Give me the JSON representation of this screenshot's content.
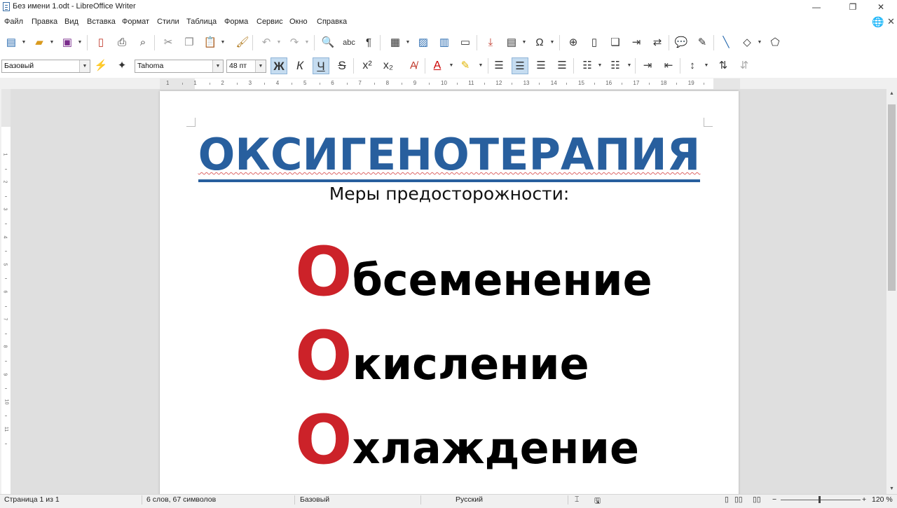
{
  "window": {
    "title": "Без имени 1.odt - LibreOffice Writer",
    "minimize": "—",
    "restore": "❐",
    "close": "✕"
  },
  "menu": {
    "items": [
      "Файл",
      "Правка",
      "Вид",
      "Вставка",
      "Формат",
      "Стили",
      "Таблица",
      "Форма",
      "Сервис",
      "Окно",
      "Справка"
    ]
  },
  "formatting": {
    "paragraph_style": "Базовый",
    "font_name": "Tahoma",
    "font_size": "48 пт",
    "bold_label": "Ж",
    "italic_label": "К",
    "underline_label": "Ч",
    "strike_label": "S",
    "superscript_label": "x²",
    "subscript_label": "x₂"
  },
  "ruler": {
    "h_labels": [
      "1",
      "1",
      "2",
      "3",
      "4",
      "5",
      "6",
      "7",
      "8",
      "9",
      "10",
      "11",
      "12",
      "13",
      "14",
      "15",
      "16",
      "17",
      "18",
      "19"
    ],
    "v_labels": [
      "1",
      "2",
      "3",
      "4",
      "5",
      "6",
      "7",
      "8",
      "9",
      "10",
      "11"
    ]
  },
  "document": {
    "heading": "ОКСИГЕНОТЕРАПИЯ",
    "subtitle": "Меры предосторожности:",
    "lines": [
      {
        "cap": "О",
        "rest": "бсеменение"
      },
      {
        "cap": "О",
        "rest": "кисление"
      },
      {
        "cap": "О",
        "rest": "хлаждение"
      }
    ]
  },
  "status": {
    "page": "Страница 1 из 1",
    "words": "6 слов, 67 символов",
    "style": "Базовый",
    "language": "Русский",
    "zoom": "120 %"
  },
  "colors": {
    "heading": "#285f9e",
    "accent_letter": "#cc2229"
  }
}
